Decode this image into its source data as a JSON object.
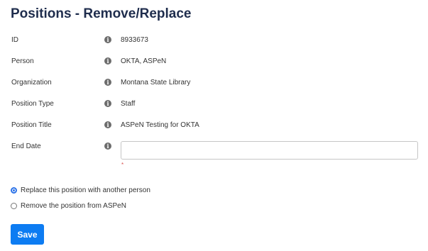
{
  "page": {
    "title": "Positions - Remove/Replace"
  },
  "fields": [
    {
      "label": "ID",
      "value": "8933673"
    },
    {
      "label": "Person",
      "value": "OKTA, ASPeN"
    },
    {
      "label": "Organization",
      "value": "Montana State Library"
    },
    {
      "label": "Position Type",
      "value": "Staff"
    },
    {
      "label": "Position Title",
      "value": "ASPeN Testing for OKTA"
    }
  ],
  "end_date": {
    "label": "End Date",
    "value": "",
    "placeholder": "",
    "required_mark": "*"
  },
  "info_icon_glyph": "i",
  "options": {
    "replace_label": "Replace this position with another person",
    "remove_label": "Remove the position from ASPeN",
    "selected": "replace"
  },
  "actions": {
    "save_label": "Save"
  },
  "colors": {
    "title": "#1f2d4d",
    "primary": "#0d7cf2",
    "required": "#d9534f",
    "info_icon": "#6c6c6c"
  }
}
